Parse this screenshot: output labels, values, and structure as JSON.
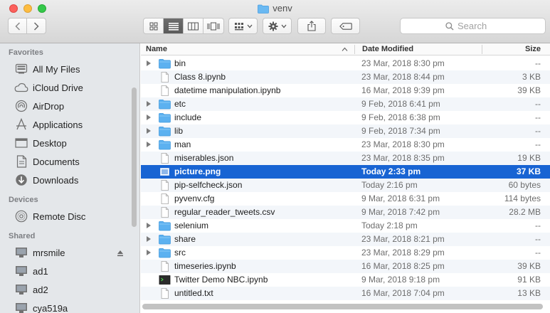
{
  "window": {
    "title": "venv"
  },
  "toolbar": {
    "back_icon": "chevron-left-icon",
    "forward_icon": "chevron-right-icon",
    "view_icons": [
      "icon-view-icon",
      "list-view-icon",
      "column-view-icon",
      "cover-flow-icon"
    ],
    "share_icon": "share-icon",
    "tag_icon": "tag-icon"
  },
  "search": {
    "placeholder": "Search"
  },
  "sidebar": {
    "favorites_title": "Favorites",
    "favorites": [
      {
        "label": "All My Files",
        "icon": "all-files-icon"
      },
      {
        "label": "iCloud Drive",
        "icon": "cloud-icon"
      },
      {
        "label": "AirDrop",
        "icon": "airdrop-icon"
      },
      {
        "label": "Applications",
        "icon": "applications-icon"
      },
      {
        "label": "Desktop",
        "icon": "desktop-icon"
      },
      {
        "label": "Documents",
        "icon": "documents-icon"
      },
      {
        "label": "Downloads",
        "icon": "downloads-icon"
      }
    ],
    "devices_title": "Devices",
    "devices": [
      {
        "label": "Remote Disc",
        "icon": "disc-icon"
      }
    ],
    "shared_title": "Shared",
    "shared": [
      {
        "label": "mrsmile",
        "icon": "computer-icon"
      },
      {
        "label": "ad1",
        "icon": "computer-icon"
      },
      {
        "label": "ad2",
        "icon": "computer-icon"
      },
      {
        "label": "cya519a",
        "icon": "computer-icon"
      }
    ]
  },
  "columns": {
    "name": "Name",
    "date": "Date Modified",
    "size": "Size"
  },
  "files": [
    {
      "name": "bin",
      "date": "23 Mar, 2018 8:30 pm",
      "size": "--",
      "kind": "folder"
    },
    {
      "name": "Class 8.ipynb",
      "date": "23 Mar, 2018 8:44 pm",
      "size": "3 KB",
      "kind": "file"
    },
    {
      "name": "datetime manipulation.ipynb",
      "date": "16 Mar, 2018 9:39 pm",
      "size": "39 KB",
      "kind": "file"
    },
    {
      "name": "etc",
      "date": "9 Feb, 2018 6:41 pm",
      "size": "--",
      "kind": "folder"
    },
    {
      "name": "include",
      "date": "9 Feb, 2018 6:38 pm",
      "size": "--",
      "kind": "folder"
    },
    {
      "name": "lib",
      "date": "9 Feb, 2018 7:34 pm",
      "size": "--",
      "kind": "folder"
    },
    {
      "name": "man",
      "date": "23 Mar, 2018 8:30 pm",
      "size": "--",
      "kind": "folder"
    },
    {
      "name": "miserables.json",
      "date": "23 Mar, 2018 8:35 pm",
      "size": "19 KB",
      "kind": "file"
    },
    {
      "name": "picture.png",
      "date": "Today 2:33 pm",
      "size": "37 KB",
      "kind": "image",
      "selected": true
    },
    {
      "name": "pip-selfcheck.json",
      "date": "Today 2:16 pm",
      "size": "60 bytes",
      "kind": "file"
    },
    {
      "name": "pyvenv.cfg",
      "date": "9 Mar, 2018 6:31 pm",
      "size": "114 bytes",
      "kind": "file"
    },
    {
      "name": "regular_reader_tweets.csv",
      "date": "9 Mar, 2018 7:42 pm",
      "size": "28.2 MB",
      "kind": "file"
    },
    {
      "name": "selenium",
      "date": "Today 2:18 pm",
      "size": "--",
      "kind": "folder"
    },
    {
      "name": "share",
      "date": "23 Mar, 2018 8:21 pm",
      "size": "--",
      "kind": "folder"
    },
    {
      "name": "src",
      "date": "23 Mar, 2018 8:29 pm",
      "size": "--",
      "kind": "folder"
    },
    {
      "name": "timeseries.ipynb",
      "date": "16 Mar, 2018 8:25 pm",
      "size": "39 KB",
      "kind": "file"
    },
    {
      "name": "Twitter Demo NBC.ipynb",
      "date": "9 Mar, 2018 9:18 pm",
      "size": "91 KB",
      "kind": "terminal"
    },
    {
      "name": "untitled.txt",
      "date": "16 Mar, 2018 7:04 pm",
      "size": "13 KB",
      "kind": "file"
    }
  ],
  "colors": {
    "selection": "#1864d3",
    "folder": "#5cb1f0",
    "sidebar_bg": "#e4e7ea"
  }
}
